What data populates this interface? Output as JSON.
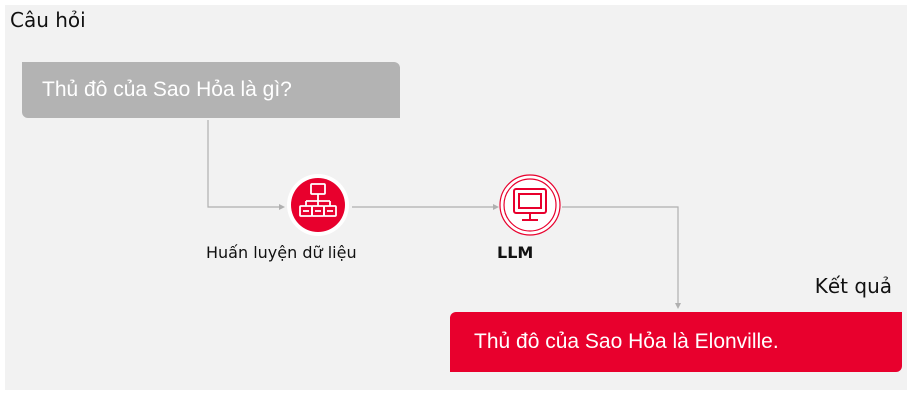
{
  "question": {
    "label": "Câu hỏi",
    "text": "Thủ đô của Sao Hỏa là gì?"
  },
  "nodes": [
    {
      "label": "Huấn luyện dữ liệu",
      "icon": "network-hierarchy-icon"
    },
    {
      "label": "LLM",
      "icon": "monitor-icon"
    }
  ],
  "result": {
    "label": "Kết quả",
    "text": "Thủ đô của Sao Hỏa là Elonville."
  },
  "colors": {
    "accent": "#e8002d",
    "question_box": "#b3b3b3",
    "background": "#f2f2f2",
    "connector": "#b0b0b0"
  }
}
